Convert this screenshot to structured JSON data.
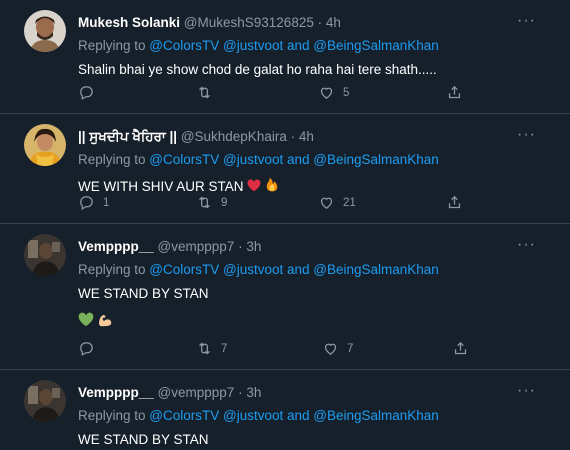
{
  "tweets": [
    {
      "name": "Mukesh Solanki",
      "handle": "@MukeshS93126825",
      "time": "4h",
      "replying_prefix": "Replying to ",
      "replying_to": "@ColorsTV @justvoot and @BeingSalmanKhan",
      "text": "Shalin bhai ye show chod de galat ho raha hai tere shath.....",
      "text2": "",
      "replies": "",
      "retweets": "",
      "likes": "5"
    },
    {
      "name": "|| ਸੁਖਦੀਪ ਖੈਹਿਰਾ ||",
      "handle": "@SukhdepKhaira",
      "time": "4h",
      "replying_prefix": "Replying to ",
      "replying_to": "@ColorsTV @justvoot and @BeingSalmanKhan",
      "text": "WE WITH SHIV AUR STAN",
      "text2": "",
      "replies": "1",
      "retweets": "9",
      "likes": "21"
    },
    {
      "name": "Vempppp__",
      "handle": "@vempppp7",
      "time": "3h",
      "replying_prefix": "Replying to ",
      "replying_to": "@ColorsTV @justvoot and @BeingSalmanKhan",
      "text": "WE STAND BY STAN",
      "text2": "",
      "replies": "",
      "retweets": "7",
      "likes": "7"
    },
    {
      "name": "Vempppp__",
      "handle": "@vempppp7",
      "time": "3h",
      "replying_prefix": "Replying to ",
      "replying_to": "@ColorsTV @justvoot and @BeingSalmanKhan",
      "text": "WE STAND BY STAN",
      "text2": "",
      "replies": "",
      "retweets": "",
      "likes": ""
    }
  ],
  "separator": "·",
  "more_glyph": "···",
  "colors": {
    "background": "#15202b",
    "link": "#1d9bf0",
    "secondary": "#8b98a5",
    "border": "#38444d"
  },
  "icons": {
    "reply": "reply-icon",
    "retweet": "retweet-icon",
    "like": "heart-icon",
    "share": "share-icon",
    "more": "more-icon"
  }
}
